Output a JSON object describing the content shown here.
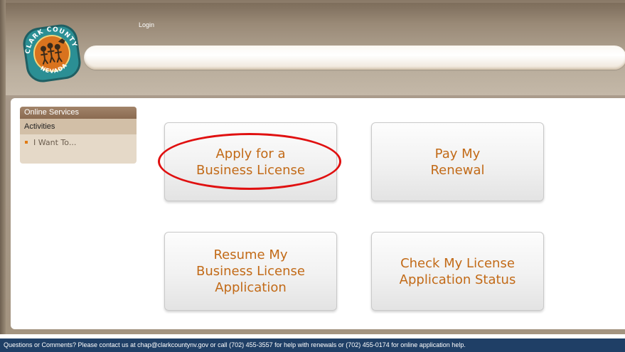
{
  "header": {
    "login_label": "Login",
    "logo": {
      "top_text": "CLARK COUNTY",
      "bottom_text": "NEVADA"
    }
  },
  "sidebar": {
    "title": "Online Services",
    "section": "Activities",
    "items": [
      {
        "label": "I Want To..."
      }
    ]
  },
  "tiles": [
    {
      "label": "Apply for a\nBusiness License"
    },
    {
      "label": "Pay My\nRenewal"
    },
    {
      "label": "Resume My\nBusiness License\nApplication"
    },
    {
      "label": "Check My License\nApplication Status"
    }
  ],
  "footer": {
    "text": "Questions or Comments? Please contact us at chap@clarkcountynv.gov or call (702) 455-3557 for help with renewals or (702) 455-0174 for online application help."
  },
  "colors": {
    "tile_text": "#c26a17",
    "highlight": "#e01010",
    "footer_bg": "#1f3f66",
    "sidebar_title_bg": "#8a6a50"
  }
}
